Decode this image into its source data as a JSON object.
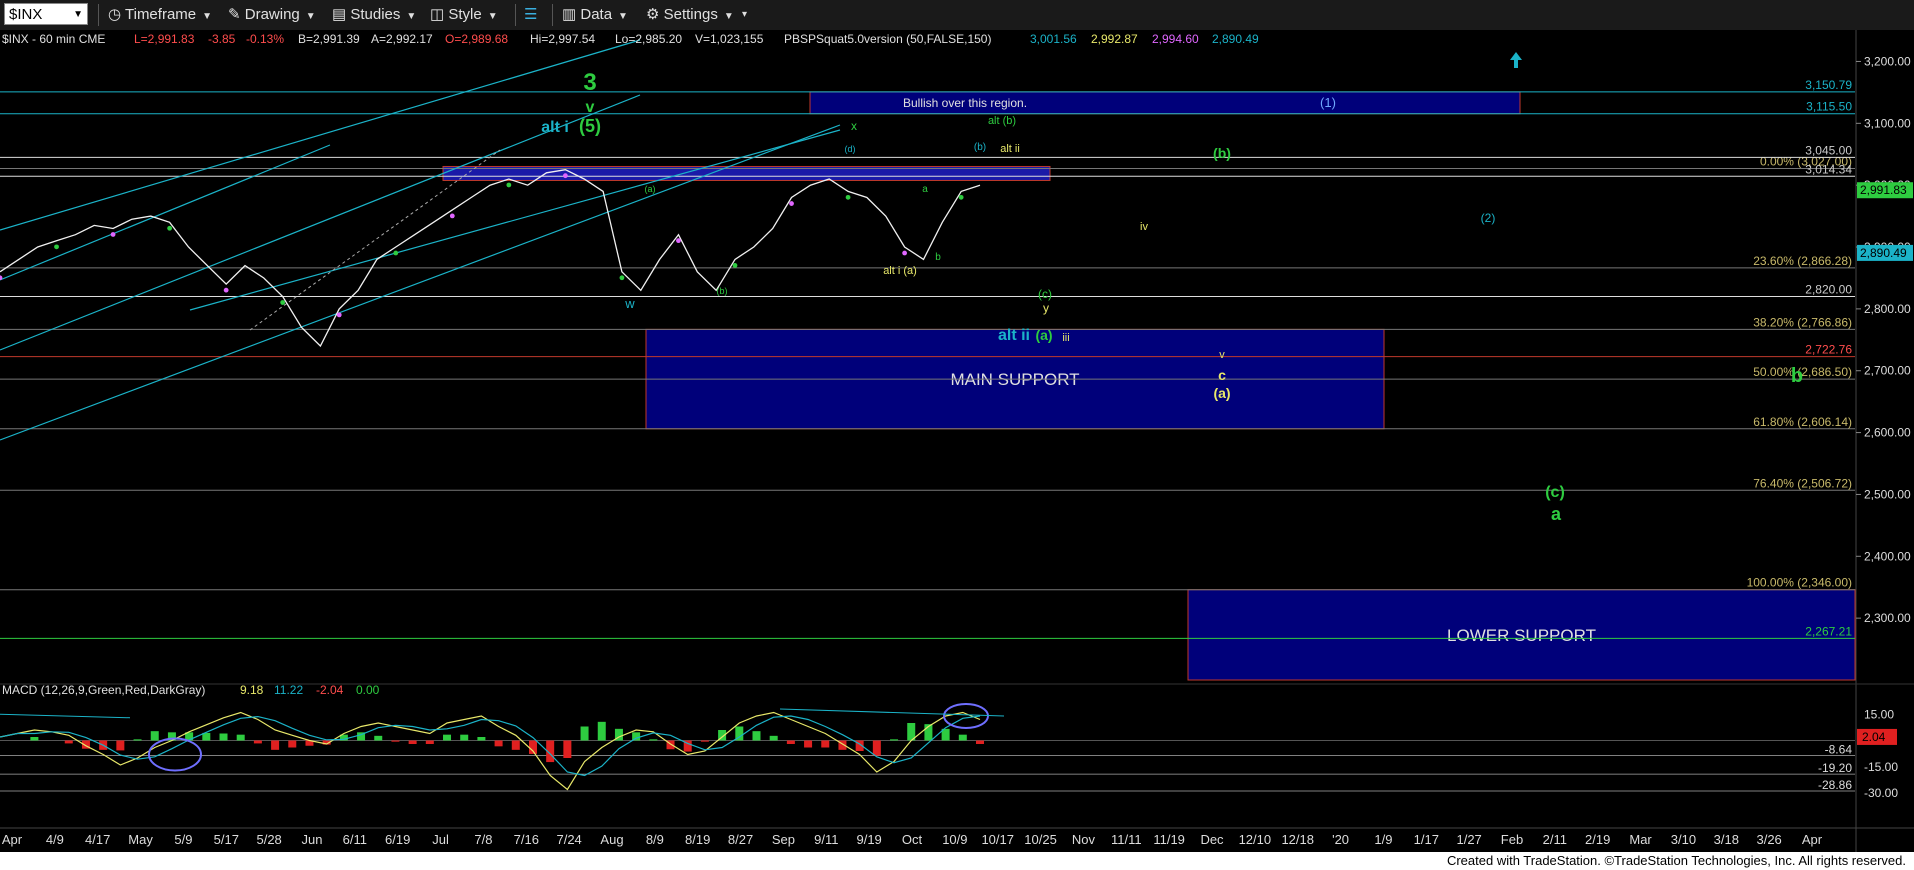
{
  "toolbar": {
    "symbol": "$INX",
    "items": [
      "Timeframe",
      "Drawing",
      "Studies",
      "Style",
      "Data",
      "Settings"
    ]
  },
  "header": {
    "main": "$INX - 60 min  CME",
    "last": "L=2,991.83",
    "chg": "-3.85",
    "pct": "-0.13%",
    "bid": "B=2,991.39",
    "ask": "A=2,992.17",
    "open": "O=2,989.68",
    "hi": "Hi=2,997.54",
    "lo": "Lo=2,985.20",
    "vol": "V=1,023,155",
    "study": "PBSPSquat5.0version (50,FALSE,150)",
    "study_vals": [
      "3,001.56",
      "2,992.87",
      "2,994.60",
      "2,890.49"
    ]
  },
  "macd_header": {
    "label": "MACD (12,26,9,Green,Red,DarkGray)",
    "v1": "9.18",
    "v2": "11.22",
    "v3": "-2.04",
    "v4": "0.00"
  },
  "footer": "Created with TradeStation. ©TradeStation Technologies, Inc. All rights reserved.",
  "chart_data": {
    "type": "line",
    "title": "$INX - 60 min",
    "ylim": [
      2200,
      3225
    ],
    "yticks": [
      2300,
      2400,
      2500,
      2600,
      2700,
      2800,
      2900,
      3000,
      3100,
      3200
    ],
    "ytick_labels": [
      "2,300.00",
      "2,400.00",
      "2,500.00",
      "2,600.00",
      "2,700.00",
      "2,800.00",
      "2,900.00",
      "3,000.00",
      "3,100.00",
      "3,200.00"
    ],
    "x_labels": [
      "Apr",
      "4/9",
      "4/17",
      "May",
      "5/9",
      "5/17",
      "5/28",
      "Jun",
      "6/11",
      "6/19",
      "Jul",
      "7/8",
      "7/16",
      "7/24",
      "Aug",
      "8/9",
      "8/19",
      "8/27",
      "Sep",
      "9/11",
      "9/19",
      "Oct",
      "10/9",
      "10/17",
      "10/25",
      "Nov",
      "11/11",
      "11/19",
      "Dec",
      "12/10",
      "12/18",
      "'20",
      "1/9",
      "1/17",
      "1/27",
      "Feb",
      "2/11",
      "2/19",
      "Mar",
      "3/10",
      "3/18",
      "3/26",
      "Apr"
    ],
    "price_series": {
      "name": "$INX",
      "values": [
        2860,
        2880,
        2900,
        2910,
        2920,
        2935,
        2930,
        2945,
        2950,
        2940,
        2900,
        2870,
        2840,
        2870,
        2850,
        2820,
        2770,
        2740,
        2800,
        2830,
        2880,
        2900,
        2920,
        2940,
        2960,
        2980,
        3000,
        3010,
        3000,
        3020,
        3025,
        3010,
        2990,
        2860,
        2830,
        2880,
        2920,
        2860,
        2830,
        2880,
        2900,
        2930,
        2980,
        3000,
        3010,
        2990,
        2980,
        2950,
        2900,
        2880,
        2940,
        2990,
        3000
      ]
    },
    "price_markers": [
      {
        "label": "3,115.50",
        "value": 3115.5,
        "color": "#1bb3c8"
      },
      {
        "label": "3,150.79",
        "value": 3150.79,
        "color": "#1bb3c8"
      },
      {
        "label": "2,991.83",
        "value": 2991.83,
        "color": "#2ecc40"
      },
      {
        "label": "2,890.49",
        "value": 2890.49,
        "color": "#1bb3c8"
      }
    ],
    "fib_levels": [
      {
        "label": "0.00% (3,027.00)",
        "value": 3027
      },
      {
        "label": "23.60% (2,866.28)",
        "value": 2866.28
      },
      {
        "label": "38.20% (2,766.86)",
        "value": 2766.86
      },
      {
        "label": "50.00% (2,686.50)",
        "value": 2686.5
      },
      {
        "label": "61.80% (2,606.14)",
        "value": 2606.14
      },
      {
        "label": "76.40% (2,506.72)",
        "value": 2506.72
      },
      {
        "label": "100.00% (2,346.00)",
        "value": 2346
      }
    ],
    "level_labels": [
      {
        "label": "3,045.00",
        "value": 3045
      },
      {
        "label": "3,014.34",
        "value": 3014.34
      },
      {
        "label": "2,820.00",
        "value": 2820
      },
      {
        "label": "2,722.76",
        "value": 2722.76
      },
      {
        "label": "2,267.21",
        "value": 2267.21
      }
    ],
    "regions": [
      {
        "label": "Bullish over this region.",
        "sublabel": "(1)",
        "from": 3115.5,
        "to": 3150.79
      },
      {
        "label": "MAIN SUPPORT",
        "from": 2606.14,
        "to": 2766.86
      },
      {
        "label": "LOWER SUPPORT",
        "from": 2200,
        "to": 2346
      }
    ],
    "wave_labels": [
      "3",
      "v",
      "(5)",
      "alt i",
      "x",
      "alt (b)",
      "(b)",
      "alt ii",
      "(b)",
      "a",
      "b",
      "alt i (a)",
      "(a)",
      "(b)",
      "w",
      "(c)",
      "y",
      "alt ii",
      "(a)",
      "iii",
      "iv",
      "(2)",
      "v",
      "c",
      "(a)",
      "b",
      "(c)",
      "a",
      "(d)"
    ],
    "macd": {
      "ylim": [
        -34,
        22
      ],
      "yticks": [
        15,
        -15,
        -30
      ],
      "ytick_labels": [
        "15.00",
        "-15.00",
        "-30.00"
      ],
      "markers": [
        {
          "label": "-8.64",
          "value": -8.64
        },
        {
          "label": "-19.20",
          "value": -19.2
        },
        {
          "label": "-28.86",
          "value": -28.86
        }
      ],
      "current_label": "2.04",
      "values": [
        2,
        4,
        6,
        5,
        3,
        -3,
        -8,
        -14,
        -10,
        -4,
        0,
        5,
        9,
        13,
        16,
        12,
        6,
        3,
        0,
        -2,
        4,
        8,
        10,
        8,
        6,
        4,
        10,
        12,
        14,
        8,
        3,
        -6,
        -20,
        -28,
        -12,
        -4,
        2,
        6,
        5,
        -2,
        -8,
        -6,
        2,
        10,
        14,
        16,
        12,
        8,
        4,
        -2,
        -8,
        -18,
        -12,
        0,
        8,
        14,
        16,
        12
      ]
    }
  }
}
